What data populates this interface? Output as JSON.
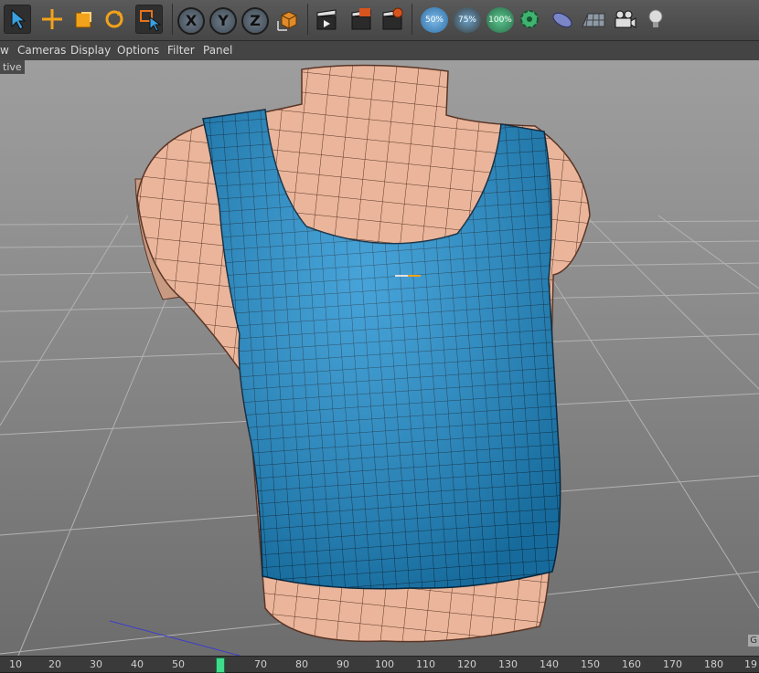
{
  "menu": [
    "w",
    "Cameras",
    "Display",
    "Options",
    "Filter",
    "Panel"
  ],
  "viewport": {
    "label": "tive",
    "corner": "G"
  },
  "toolbar": {
    "pct_50": "50%",
    "pct_75": "75%",
    "pct_100": "100%"
  },
  "axes": [
    "X",
    "Y",
    "Z"
  ],
  "timeline": {
    "ticks": [
      "10",
      "20",
      "30",
      "40",
      "50",
      "70",
      "80",
      "90",
      "100",
      "110",
      "120",
      "130",
      "140",
      "150",
      "160",
      "170",
      "180",
      "19"
    ]
  },
  "colors": {
    "shirt": "#1e8fd0",
    "skin": "#eab59a",
    "playhead": "#3fdc8c"
  }
}
